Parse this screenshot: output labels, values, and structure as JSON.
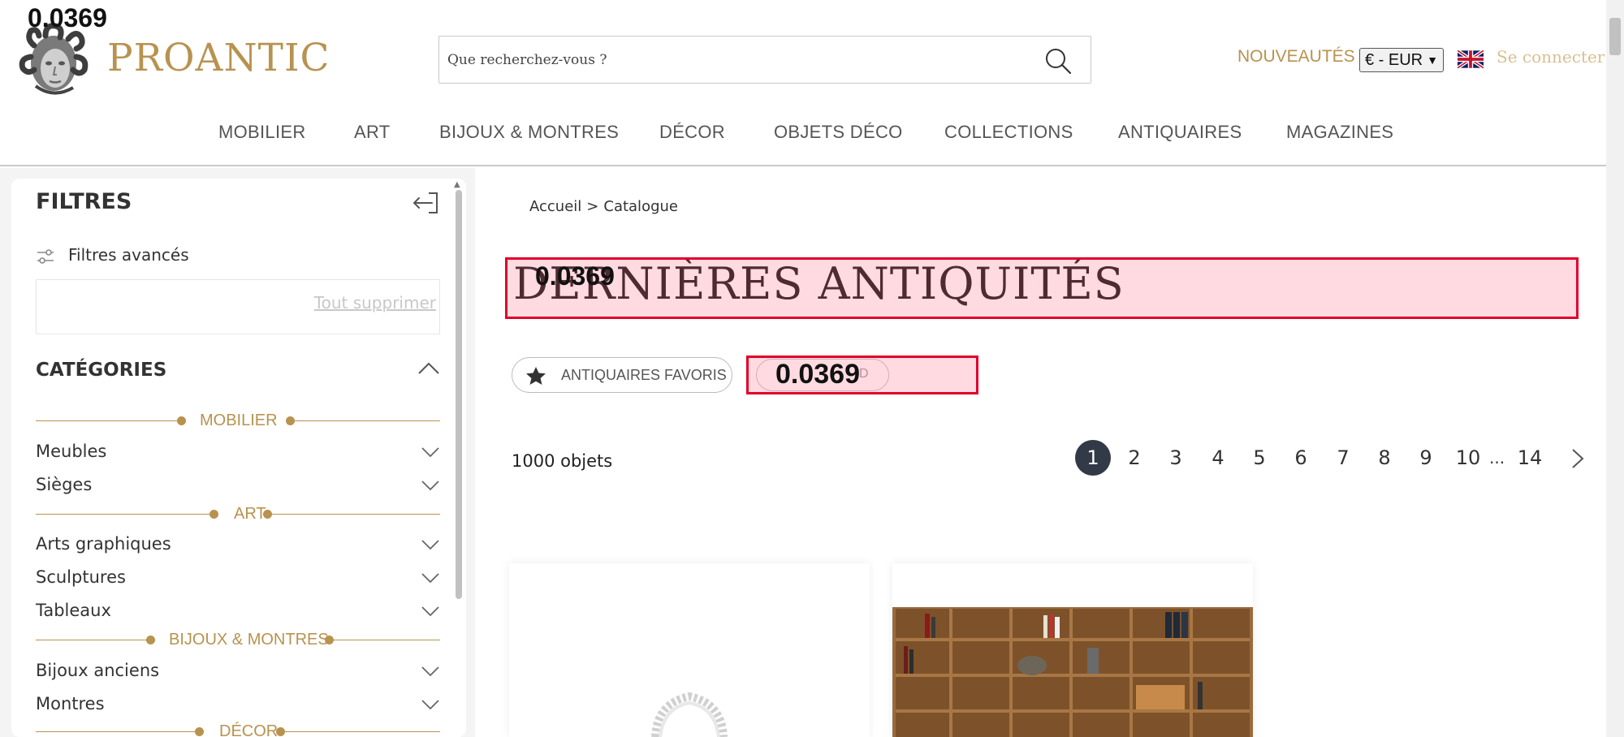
{
  "debug": {
    "score_label": "0.0369"
  },
  "header": {
    "brand": "PROANTIC",
    "search_placeholder": "Que recherchez-vous ?",
    "nouveautes": "NOUVEAUTÉS",
    "currency": "€ - EUR",
    "login": "Se connecter",
    "nav": [
      "MOBILIER",
      "ART",
      "BIJOUX & MONTRES",
      "DÉCOR",
      "OBJETS DÉCO",
      "COLLECTIONS",
      "ANTIQUAIRES",
      "MAGAZINES"
    ]
  },
  "sidebar": {
    "title": "FILTRES",
    "advanced_filters": "Filtres avancés",
    "clear_all": "Tout supprimer",
    "categories_title": "CATÉGORIES",
    "groups": [
      {
        "name": "MOBILIER",
        "items": [
          "Meubles",
          "Sièges"
        ]
      },
      {
        "name": "ART",
        "items": [
          "Arts graphiques",
          "Sculptures",
          "Tableaux"
        ]
      },
      {
        "name": "BIJOUX & MONTRES",
        "items": [
          "Bijoux anciens",
          "Montres"
        ]
      },
      {
        "name": "DÉCOR",
        "items": []
      }
    ]
  },
  "main": {
    "breadcrumb": [
      "Accueil",
      ">",
      "Catalogue"
    ],
    "title": "DERNIÈRES ANTIQUITÉS",
    "favorites_button": "ANTIQUAIRES FAVORIS",
    "sold_button_suffix": "D",
    "count": "1000 objets",
    "pagination": {
      "current": "1",
      "pages": [
        "1",
        "2",
        "3",
        "4",
        "5",
        "6",
        "7",
        "8",
        "9",
        "10"
      ],
      "ellipsis": "...",
      "last": "14"
    }
  },
  "colors": {
    "gold": "#b8924f",
    "active_page": "#323a47",
    "debug_red": "#e0002a"
  }
}
